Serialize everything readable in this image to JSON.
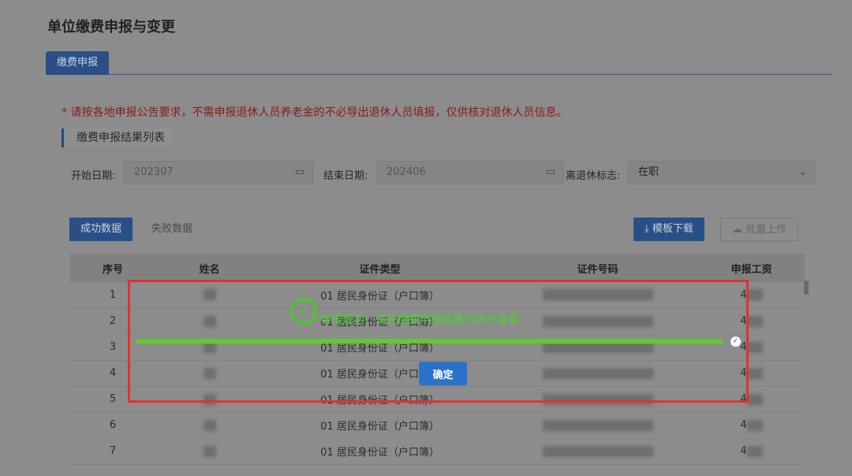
{
  "title": "单位缴费申报与变更",
  "tab": "缴费申报",
  "notice": "* 请按各地申报公告要求，不需申报退休人员养老金的不必导出退休人员填报，仅供核对退休人员信息。",
  "section": "缴费申报结果列表",
  "filters": {
    "start_label": "开始日期:",
    "start_value": "202307",
    "end_label": "结束日期:",
    "end_value": "202406",
    "retire_label": "离退休标志:",
    "retire_value": "在职"
  },
  "subtabs": {
    "success": "成功数据",
    "fail": "失败数据"
  },
  "buttons": {
    "download": "模板下载",
    "upload": "批量上传"
  },
  "table": {
    "headers": [
      "序号",
      "姓名",
      "证件类型",
      "证件号码",
      "申报工资"
    ],
    "rows": [
      {
        "no": "1",
        "type": "01 居民身份证（户口簿）",
        "wage": "4"
      },
      {
        "no": "2",
        "type": "01 居民身份证（户口簿）",
        "wage": "4"
      },
      {
        "no": "3",
        "type": "01 居民身份证（户口簿）",
        "wage": "4"
      },
      {
        "no": "4",
        "type": "01 居民身份证（户口簿）",
        "wage": "4"
      },
      {
        "no": "5",
        "type": "01 居民身份证（户口簿）",
        "wage": "4"
      },
      {
        "no": "6",
        "type": "01 居民身份证（户口簿）",
        "wage": "4"
      },
      {
        "no": "7",
        "type": "01 居民身份证（户口簿）",
        "wage": "4"
      }
    ]
  },
  "dialog": {
    "message": "申报成功，请在缴费申报结果列表中查看",
    "progress": 100,
    "confirm": "确定"
  }
}
